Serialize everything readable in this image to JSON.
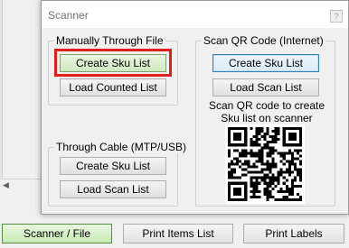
{
  "dialog": {
    "title": "Scanner",
    "help_glyph": "?",
    "manual_group": {
      "label": "Manually Through File",
      "create_label": "Create Sku List",
      "load_label": "Load Counted List"
    },
    "cable_group": {
      "label": "Through Cable (MTP/USB)",
      "create_label": "Create Sku List",
      "load_label": "Load Scan List"
    },
    "qr_group": {
      "label": "Scan QR Code (Internet)",
      "create_label": "Create Sku List",
      "load_label": "Load Scan List",
      "hint_line1": "Scan QR code to create",
      "hint_line2": "Sku list on scanner"
    }
  },
  "scrollbar": {
    "left_arrow": "◀",
    "right_arrow": "▶"
  },
  "bottom_bar": {
    "scanner_label": "Scanner / File",
    "print_items_label": "Print Items List",
    "print_labels_label": "Print Labels"
  },
  "colors": {
    "highlight": "#e0201c",
    "active_green": "#c8ecb4",
    "focus_blue": "#3c7fb1"
  }
}
